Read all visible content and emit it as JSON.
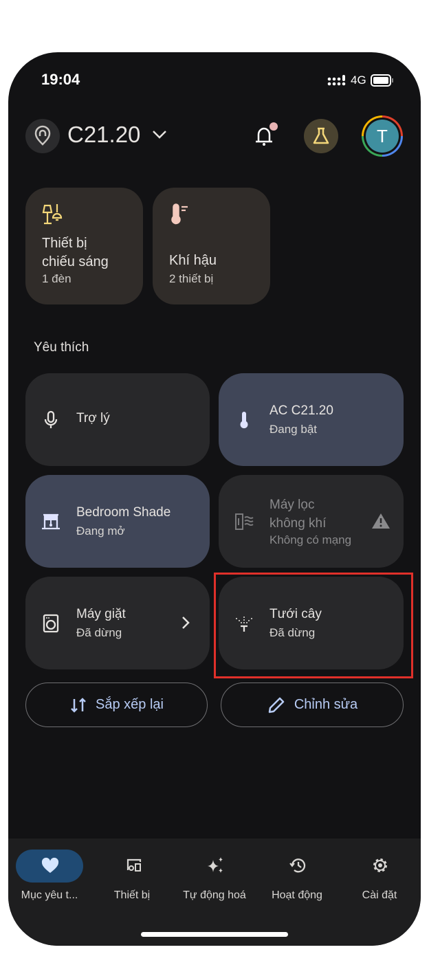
{
  "status_bar": {
    "time": "19:04",
    "network": "4G"
  },
  "header": {
    "home_name": "C21.20",
    "notification_dot_color": "#e8b4b4",
    "avatar_initial": "T",
    "avatar_color": "#3f8fa0"
  },
  "categories": [
    {
      "title": "Thiết bị chiếu sáng",
      "title_line1": "Thiết bị",
      "title_line2": "chiếu sáng",
      "subtitle": "1 đèn",
      "icon": "lamp-icon"
    },
    {
      "title": "Khí hậu",
      "subtitle": "2 thiết bị",
      "icon": "thermostat-icon"
    }
  ],
  "favorites_label": "Yêu thích",
  "favorites": [
    {
      "title": "Trợ lý",
      "icon": "microphone-icon"
    },
    {
      "title": "AC C21.20",
      "status": "Đang bật",
      "icon": "thermometer-icon",
      "active": true
    },
    {
      "title": "Bedroom Shade",
      "status": "Đang mở",
      "icon": "shade-icon",
      "active": true
    },
    {
      "title_line1": "Máy lọc",
      "title_line2": "không khí",
      "status": "Không có mạng",
      "icon": "air-purifier-icon",
      "warning": true
    },
    {
      "title": "Máy giặt",
      "status": "Đã dừng",
      "icon": "washer-icon"
    },
    {
      "title": "Tưới cây",
      "status": "Đã dừng",
      "icon": "sprinkler-icon",
      "highlighted": true
    }
  ],
  "actions": {
    "reorder": "Sắp xếp lại",
    "edit": "Chỉnh sửa"
  },
  "nav": [
    {
      "label": "Mục yêu t...",
      "icon": "heart-icon",
      "active": true
    },
    {
      "label": "Thiết bị",
      "icon": "devices-icon"
    },
    {
      "label": "Tự động hoá",
      "icon": "sparkle-icon"
    },
    {
      "label": "Hoạt động",
      "icon": "history-icon"
    },
    {
      "label": "Cài đặt",
      "icon": "gear-icon"
    }
  ],
  "colors": {
    "accent": "#b7cbf4",
    "active_tile": "#404658",
    "highlight_box": "#e0302a",
    "nav_active": "#1f4a73"
  }
}
